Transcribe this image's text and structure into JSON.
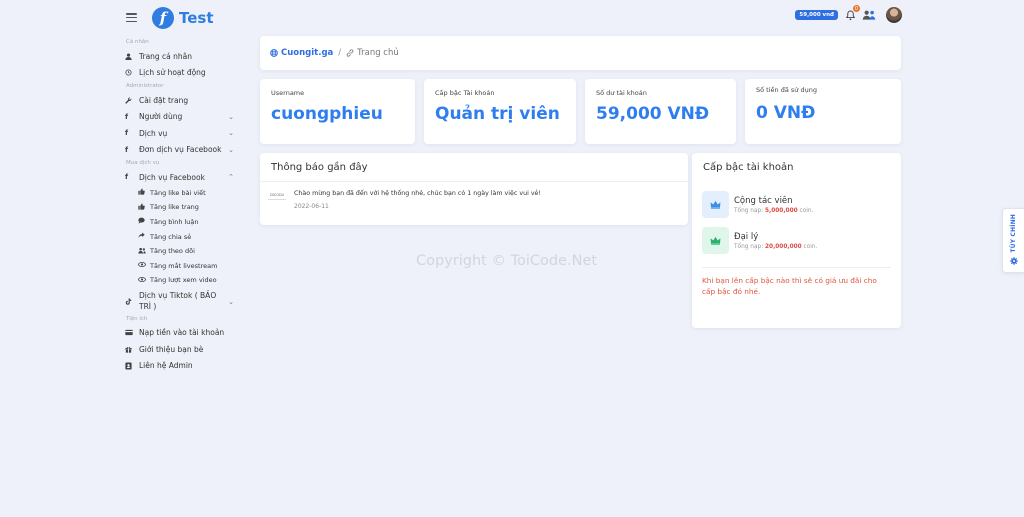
{
  "brand": {
    "logo_letter": "f",
    "name": "Test"
  },
  "topbar": {
    "balance": "59,000 vnđ",
    "notif_count": "0"
  },
  "sidebar": {
    "sections": [
      {
        "title": "Cá nhân",
        "items": [
          {
            "icon": "user-icon",
            "label": "Trang cá nhân"
          },
          {
            "icon": "history-icon",
            "label": "Lịch sử hoạt động"
          }
        ]
      },
      {
        "title": "Administrator",
        "items": [
          {
            "icon": "wrench-icon",
            "label": "Cài đặt trang"
          },
          {
            "icon": "facebook-icon",
            "label": "Người dùng",
            "chevron": "down"
          },
          {
            "icon": "facebook-icon",
            "label": "Dịch vụ",
            "chevron": "down"
          },
          {
            "icon": "facebook-icon",
            "label": "Đơn dịch vụ Facebook",
            "chevron": "down"
          }
        ]
      },
      {
        "title": "Mua dịch vụ",
        "items": [
          {
            "icon": "facebook-icon",
            "label": "Dịch vụ Facebook",
            "chevron": "up"
          }
        ]
      }
    ],
    "facebook_sub": [
      {
        "icon": "thumbs-up-icon",
        "label": "Tăng like bài viết"
      },
      {
        "icon": "thumbs-up-icon",
        "label": "Tăng like trang"
      },
      {
        "icon": "comment-icon",
        "label": "Tăng bình luận"
      },
      {
        "icon": "share-icon",
        "label": "Tăng chia sẻ"
      },
      {
        "icon": "users-icon",
        "label": "Tăng theo dõi"
      },
      {
        "icon": "eye-icon",
        "label": "Tăng mắt livestream"
      },
      {
        "icon": "eye-icon",
        "label": "Tăng lượt xem video"
      }
    ],
    "tiktok": {
      "icon": "tiktok-icon",
      "label": "Dịch vụ Tiktok ( BẢO TRÌ )"
    },
    "utility_title": "Tiện ích",
    "utility_items": [
      {
        "icon": "credit-card-icon",
        "label": "Nạp tiền vào tài khoản"
      },
      {
        "icon": "gift-icon",
        "label": "Giới thiệu bạn bè"
      },
      {
        "icon": "contact-icon",
        "label": "Liên hệ Admin"
      }
    ]
  },
  "breadcrumb": {
    "home": "Cuongit.ga",
    "sep": "/",
    "current": "Trang chủ"
  },
  "stats": [
    {
      "label": "Username",
      "value": "cuongphieu"
    },
    {
      "label": "Cấp bậc Tài khoản",
      "value": "Quản trị viên"
    },
    {
      "label": "Số dư tài khoản",
      "value": "59,000 VNĐ"
    },
    {
      "label": "Số tiền đã sử dụng",
      "value": "0 VNĐ"
    }
  ],
  "notices": {
    "title": "Thông báo gần đây",
    "items": [
      {
        "thumb": "DICOD4",
        "text": "Chào mừng bạn đã đến với hệ thống nhé, chúc bạn có 1 ngày làm việc vui vẻ!",
        "date": "2022-06-11"
      }
    ]
  },
  "tiers": {
    "title": "Cấp bậc tài khoản",
    "items": [
      {
        "name": "Cộng tác viên",
        "prefix": "Tổng nạp:",
        "amount": "5,000,000",
        "suffix": "coin.",
        "color": "#3b8fe6",
        "bg": "#e3effc"
      },
      {
        "name": "Đại lý",
        "prefix": "Tổng nạp:",
        "amount": "20,000,000",
        "suffix": "coin.",
        "color": "#28b36a",
        "bg": "#e1f6ea"
      }
    ],
    "note": "Khi bạn lên cấp bậc nào thì sẽ có giá ưu đãi cho cấp bậc đó nhé."
  },
  "watermark": "Copyright © ToiCode.Net",
  "customize": {
    "label": "TÙY CHỈNH"
  }
}
